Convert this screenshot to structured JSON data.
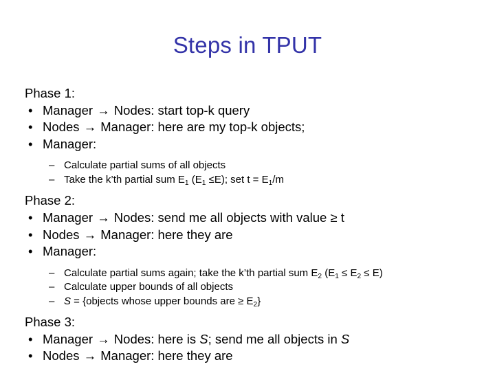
{
  "slide": {
    "title": "Steps in TPUT",
    "title_color": "#3333a8",
    "background_color": "#ffffff",
    "text_color": "#000000",
    "bullet_marker": "•",
    "sub_bullet_marker": "–",
    "arrow_glyph": "→",
    "blocks": [
      {
        "heading": "Phase 1:",
        "bullets": [
          {
            "pre": "Manager ",
            "arrow": "→",
            "post": " Nodes: start top-k query"
          },
          {
            "pre": "Nodes ",
            "arrow": "→",
            "post": " Manager: here are my top-k objects;"
          },
          {
            "pre": "Manager:",
            "arrow": "",
            "post": ""
          }
        ],
        "sub_bullets": [
          {
            "parts": [
              {
                "t": "Calculate partial sums of all objects",
                "s": "plain"
              }
            ]
          },
          {
            "parts": [
              {
                "t": "Take the k’th partial sum E",
                "s": "plain"
              },
              {
                "t": "1",
                "s": "sub"
              },
              {
                "t": " (E",
                "s": "plain"
              },
              {
                "t": "1",
                "s": "sub"
              },
              {
                "t": " ≤E); set t = E",
                "s": "plain"
              },
              {
                "t": "1",
                "s": "sub"
              },
              {
                "t": "/m",
                "s": "plain"
              }
            ]
          }
        ]
      },
      {
        "heading": "Phase 2:",
        "bullets": [
          {
            "pre": "Manager ",
            "arrow": "→",
            "post": " Nodes: send me all objects with value ≥ t"
          },
          {
            "pre": "Nodes ",
            "arrow": "→",
            "post": " Manager: here they are"
          },
          {
            "pre": "Manager:",
            "arrow": "",
            "post": ""
          }
        ],
        "sub_bullets": [
          {
            "parts": [
              {
                "t": "Calculate partial sums again; take the k’th partial sum E",
                "s": "plain"
              },
              {
                "t": "2",
                "s": "sub"
              },
              {
                "t": " (E",
                "s": "plain"
              },
              {
                "t": "1",
                "s": "sub"
              },
              {
                "t": " ≤ E",
                "s": "plain"
              },
              {
                "t": "2",
                "s": "sub"
              },
              {
                "t": " ≤ E)",
                "s": "plain"
              }
            ]
          },
          {
            "parts": [
              {
                "t": "Calculate upper bounds of all objects",
                "s": "plain"
              }
            ]
          },
          {
            "parts": [
              {
                "t": "S",
                "s": "italic"
              },
              {
                "t": " = {objects whose upper bounds are ≥ E",
                "s": "plain"
              },
              {
                "t": "2",
                "s": "sub"
              },
              {
                "t": "}",
                "s": "plain"
              }
            ]
          }
        ]
      },
      {
        "heading": "Phase 3:",
        "bullets": [
          {
            "pre": "Manager ",
            "arrow": "→",
            "post": " Nodes: here is ",
            "italic_tail": "S",
            "post2": "; send me all objects in ",
            "italic_tail2": "S"
          },
          {
            "pre": "Nodes ",
            "arrow": "→",
            "post": " Manager: here they are"
          }
        ],
        "sub_bullets": []
      }
    ]
  }
}
